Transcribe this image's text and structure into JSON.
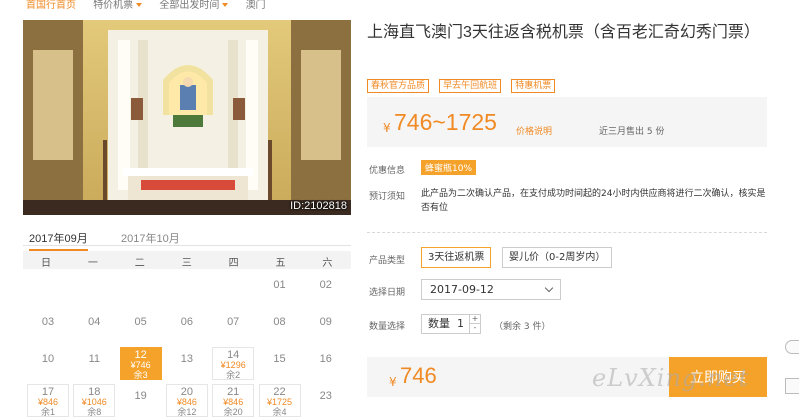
{
  "breadcrumb": {
    "items": [
      "首国行首页",
      "特价机票",
      "全部出发时间",
      "澳门"
    ]
  },
  "photo": {
    "id": "ID:2102818"
  },
  "calendar": {
    "tabs": [
      "2017年09月",
      "2017年10月"
    ],
    "weekdays": [
      "日",
      "一",
      "二",
      "三",
      "四",
      "五",
      "六"
    ],
    "cells": [
      {
        "day": "01",
        "col": 5,
        "row": 0
      },
      {
        "day": "02",
        "col": 6,
        "row": 0
      },
      {
        "day": "03",
        "col": 0,
        "row": 1
      },
      {
        "day": "04",
        "col": 1,
        "row": 1
      },
      {
        "day": "05",
        "col": 2,
        "row": 1
      },
      {
        "day": "06",
        "col": 3,
        "row": 1
      },
      {
        "day": "07",
        "col": 4,
        "row": 1
      },
      {
        "day": "08",
        "col": 5,
        "row": 1
      },
      {
        "day": "09",
        "col": 6,
        "row": 1
      },
      {
        "day": "10",
        "col": 0,
        "row": 2
      },
      {
        "day": "11",
        "col": 1,
        "row": 2
      },
      {
        "day": "12",
        "col": 2,
        "row": 2,
        "price": "¥746",
        "remain": "余3",
        "selected": true
      },
      {
        "day": "13",
        "col": 3,
        "row": 2
      },
      {
        "day": "14",
        "col": 4,
        "row": 2,
        "price": "¥1296",
        "remain": "余2"
      },
      {
        "day": "15",
        "col": 5,
        "row": 2
      },
      {
        "day": "16",
        "col": 6,
        "row": 2
      },
      {
        "day": "17",
        "col": 0,
        "row": 3,
        "price": "¥846",
        "remain": "余1"
      },
      {
        "day": "18",
        "col": 1,
        "row": 3,
        "price": "¥1046",
        "remain": "余8"
      },
      {
        "day": "19",
        "col": 2,
        "row": 3
      },
      {
        "day": "20",
        "col": 3,
        "row": 3,
        "price": "¥846",
        "remain": "余12"
      },
      {
        "day": "21",
        "col": 4,
        "row": 3,
        "price": "¥846",
        "remain": "余20"
      },
      {
        "day": "22",
        "col": 5,
        "row": 3,
        "price": "¥1725",
        "remain": "余4"
      },
      {
        "day": "23",
        "col": 6,
        "row": 3
      }
    ]
  },
  "product": {
    "title": "上海直飞澳门3天往返含税机票（含百老汇奇幻秀门票）",
    "tags": [
      "春秋官方品质",
      "早去午回航班",
      "特惠机票"
    ],
    "price_currency": "¥",
    "price_range": "746~1725",
    "price_note": "价格说明",
    "sold_text": "近三月售出 5 份",
    "promo_label": "优惠信息",
    "promo_badge": "蜂蜜瓶10%",
    "notice_label": "预订须知",
    "notice_text": "此产品为二次确认产品，在支付成功时间起的24小时内供应商将进行二次确认，核实是否有位"
  },
  "options": {
    "type_label": "产品类型",
    "type_options": [
      "3天往返机票",
      "婴儿价（0-2周岁内）"
    ],
    "date_label": "选择日期",
    "date_value": "2017-09-12",
    "qty_label": "数量选择",
    "qty_prefix": "数量",
    "qty_value": "1",
    "qty_plus": "+",
    "qty_minus": "-",
    "stock_text": "（剩余 3 件）"
  },
  "purchase": {
    "currency": "¥",
    "total": "746",
    "buy_label": "立即购买"
  },
  "watermark": "eLvXing.net",
  "colors": {
    "accent": "#f08a24",
    "button": "#f5a22b"
  }
}
